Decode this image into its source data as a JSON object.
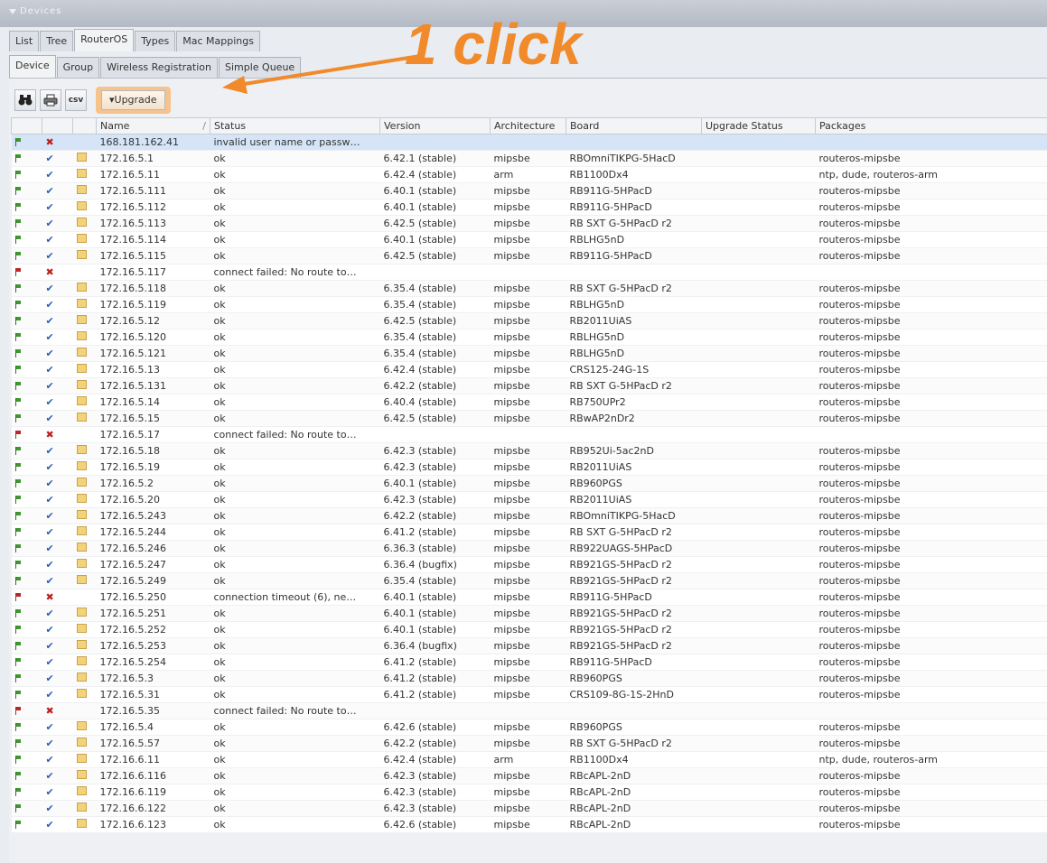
{
  "window": {
    "title": "Devices"
  },
  "top_tabs": [
    {
      "label": "List",
      "active": false
    },
    {
      "label": "Tree",
      "active": false
    },
    {
      "label": "RouterOS",
      "active": true
    },
    {
      "label": "Types",
      "active": false
    },
    {
      "label": "Mac Mappings",
      "active": false
    }
  ],
  "sub_tabs": [
    {
      "label": "Device",
      "active": true
    },
    {
      "label": "Group",
      "active": false
    },
    {
      "label": "Wireless Registration",
      "active": false
    },
    {
      "label": "Simple Queue",
      "active": false
    }
  ],
  "toolbar": {
    "find_icon": "binoculars-icon",
    "print_icon": "printer-icon",
    "csv_label": "csv",
    "upgrade_label": "▾Upgrade"
  },
  "annotation": {
    "text": "1 click",
    "color": "#f08a2a"
  },
  "columns": [
    "",
    "",
    "",
    "Name",
    "Status",
    "Version",
    "Architecture",
    "Board",
    "Upgrade Status",
    "Packages"
  ],
  "rows": [
    {
      "flag": "green",
      "ok": false,
      "lock": false,
      "name": "168.181.162.41",
      "status": "invalid user name or passw…",
      "version": "",
      "arch": "",
      "board": "",
      "upgrade": "",
      "packages": "",
      "selected": true
    },
    {
      "flag": "green",
      "ok": true,
      "lock": true,
      "name": "172.16.5.1",
      "status": "ok",
      "version": "6.42.1 (stable)",
      "arch": "mipsbe",
      "board": "RBOmniTIKPG-5HacD",
      "upgrade": "",
      "packages": "routeros-mipsbe"
    },
    {
      "flag": "green",
      "ok": true,
      "lock": true,
      "name": "172.16.5.11",
      "status": "ok",
      "version": "6.42.4 (stable)",
      "arch": "arm",
      "board": "RB1100Dx4",
      "upgrade": "",
      "packages": "ntp, dude, routeros-arm"
    },
    {
      "flag": "green",
      "ok": true,
      "lock": true,
      "name": "172.16.5.111",
      "status": "ok",
      "version": "6.40.1 (stable)",
      "arch": "mipsbe",
      "board": "RB911G-5HPacD",
      "upgrade": "",
      "packages": "routeros-mipsbe"
    },
    {
      "flag": "green",
      "ok": true,
      "lock": true,
      "name": "172.16.5.112",
      "status": "ok",
      "version": "6.40.1 (stable)",
      "arch": "mipsbe",
      "board": "RB911G-5HPacD",
      "upgrade": "",
      "packages": "routeros-mipsbe"
    },
    {
      "flag": "green",
      "ok": true,
      "lock": true,
      "name": "172.16.5.113",
      "status": "ok",
      "version": "6.42.5 (stable)",
      "arch": "mipsbe",
      "board": "RB SXT G-5HPacD r2",
      "upgrade": "",
      "packages": "routeros-mipsbe"
    },
    {
      "flag": "green",
      "ok": true,
      "lock": true,
      "name": "172.16.5.114",
      "status": "ok",
      "version": "6.40.1 (stable)",
      "arch": "mipsbe",
      "board": "RBLHG5nD",
      "upgrade": "",
      "packages": "routeros-mipsbe"
    },
    {
      "flag": "green",
      "ok": true,
      "lock": true,
      "name": "172.16.5.115",
      "status": "ok",
      "version": "6.42.5 (stable)",
      "arch": "mipsbe",
      "board": "RB911G-5HPacD",
      "upgrade": "",
      "packages": "routeros-mipsbe"
    },
    {
      "flag": "red",
      "ok": false,
      "lock": false,
      "name": "172.16.5.117",
      "status": "connect failed: No route to…",
      "version": "",
      "arch": "",
      "board": "",
      "upgrade": "",
      "packages": ""
    },
    {
      "flag": "green",
      "ok": true,
      "lock": true,
      "name": "172.16.5.118",
      "status": "ok",
      "version": "6.35.4 (stable)",
      "arch": "mipsbe",
      "board": "RB SXT G-5HPacD r2",
      "upgrade": "",
      "packages": "routeros-mipsbe"
    },
    {
      "flag": "green",
      "ok": true,
      "lock": true,
      "name": "172.16.5.119",
      "status": "ok",
      "version": "6.35.4 (stable)",
      "arch": "mipsbe",
      "board": "RBLHG5nD",
      "upgrade": "",
      "packages": "routeros-mipsbe"
    },
    {
      "flag": "green",
      "ok": true,
      "lock": true,
      "name": "172.16.5.12",
      "status": "ok",
      "version": "6.42.5 (stable)",
      "arch": "mipsbe",
      "board": "RB2011UiAS",
      "upgrade": "",
      "packages": "routeros-mipsbe"
    },
    {
      "flag": "green",
      "ok": true,
      "lock": true,
      "name": "172.16.5.120",
      "status": "ok",
      "version": "6.35.4 (stable)",
      "arch": "mipsbe",
      "board": "RBLHG5nD",
      "upgrade": "",
      "packages": "routeros-mipsbe"
    },
    {
      "flag": "green",
      "ok": true,
      "lock": true,
      "name": "172.16.5.121",
      "status": "ok",
      "version": "6.35.4 (stable)",
      "arch": "mipsbe",
      "board": "RBLHG5nD",
      "upgrade": "",
      "packages": "routeros-mipsbe"
    },
    {
      "flag": "green",
      "ok": true,
      "lock": true,
      "name": "172.16.5.13",
      "status": "ok",
      "version": "6.42.4 (stable)",
      "arch": "mipsbe",
      "board": "CRS125-24G-1S",
      "upgrade": "",
      "packages": "routeros-mipsbe"
    },
    {
      "flag": "green",
      "ok": true,
      "lock": true,
      "name": "172.16.5.131",
      "status": "ok",
      "version": "6.42.2 (stable)",
      "arch": "mipsbe",
      "board": "RB SXT G-5HPacD r2",
      "upgrade": "",
      "packages": "routeros-mipsbe"
    },
    {
      "flag": "green",
      "ok": true,
      "lock": true,
      "name": "172.16.5.14",
      "status": "ok",
      "version": "6.40.4 (stable)",
      "arch": "mipsbe",
      "board": "RB750UPr2",
      "upgrade": "",
      "packages": "routeros-mipsbe"
    },
    {
      "flag": "green",
      "ok": true,
      "lock": true,
      "name": "172.16.5.15",
      "status": "ok",
      "version": "6.42.5 (stable)",
      "arch": "mipsbe",
      "board": "RBwAP2nDr2",
      "upgrade": "",
      "packages": "routeros-mipsbe"
    },
    {
      "flag": "red",
      "ok": false,
      "lock": false,
      "name": "172.16.5.17",
      "status": "connect failed: No route to…",
      "version": "",
      "arch": "",
      "board": "",
      "upgrade": "",
      "packages": ""
    },
    {
      "flag": "green",
      "ok": true,
      "lock": true,
      "name": "172.16.5.18",
      "status": "ok",
      "version": "6.42.3 (stable)",
      "arch": "mipsbe",
      "board": "RB952Ui-5ac2nD",
      "upgrade": "",
      "packages": "routeros-mipsbe"
    },
    {
      "flag": "green",
      "ok": true,
      "lock": true,
      "name": "172.16.5.19",
      "status": "ok",
      "version": "6.42.3 (stable)",
      "arch": "mipsbe",
      "board": "RB2011UiAS",
      "upgrade": "",
      "packages": "routeros-mipsbe"
    },
    {
      "flag": "green",
      "ok": true,
      "lock": true,
      "name": "172.16.5.2",
      "status": "ok",
      "version": "6.40.1 (stable)",
      "arch": "mipsbe",
      "board": "RB960PGS",
      "upgrade": "",
      "packages": "routeros-mipsbe"
    },
    {
      "flag": "green",
      "ok": true,
      "lock": true,
      "name": "172.16.5.20",
      "status": "ok",
      "version": "6.42.3 (stable)",
      "arch": "mipsbe",
      "board": "RB2011UiAS",
      "upgrade": "",
      "packages": "routeros-mipsbe"
    },
    {
      "flag": "green",
      "ok": true,
      "lock": true,
      "name": "172.16.5.243",
      "status": "ok",
      "version": "6.42.2 (stable)",
      "arch": "mipsbe",
      "board": "RBOmniTIKPG-5HacD",
      "upgrade": "",
      "packages": "routeros-mipsbe"
    },
    {
      "flag": "green",
      "ok": true,
      "lock": true,
      "name": "172.16.5.244",
      "status": "ok",
      "version": "6.41.2 (stable)",
      "arch": "mipsbe",
      "board": "RB SXT G-5HPacD r2",
      "upgrade": "",
      "packages": "routeros-mipsbe"
    },
    {
      "flag": "green",
      "ok": true,
      "lock": true,
      "name": "172.16.5.246",
      "status": "ok",
      "version": "6.36.3 (stable)",
      "arch": "mipsbe",
      "board": "RB922UAGS-5HPacD",
      "upgrade": "",
      "packages": "routeros-mipsbe"
    },
    {
      "flag": "green",
      "ok": true,
      "lock": true,
      "name": "172.16.5.247",
      "status": "ok",
      "version": "6.36.4 (bugfix)",
      "arch": "mipsbe",
      "board": "RB921GS-5HPacD r2",
      "upgrade": "",
      "packages": "routeros-mipsbe"
    },
    {
      "flag": "green",
      "ok": true,
      "lock": true,
      "name": "172.16.5.249",
      "status": "ok",
      "version": "6.35.4 (stable)",
      "arch": "mipsbe",
      "board": "RB921GS-5HPacD r2",
      "upgrade": "",
      "packages": "routeros-mipsbe"
    },
    {
      "flag": "red",
      "ok": false,
      "lock": false,
      "name": "172.16.5.250",
      "status": "connection timeout (6), ne…",
      "version": "6.40.1 (stable)",
      "arch": "mipsbe",
      "board": "RB911G-5HPacD",
      "upgrade": "",
      "packages": "routeros-mipsbe"
    },
    {
      "flag": "green",
      "ok": true,
      "lock": true,
      "name": "172.16.5.251",
      "status": "ok",
      "version": "6.40.1 (stable)",
      "arch": "mipsbe",
      "board": "RB921GS-5HPacD r2",
      "upgrade": "",
      "packages": "routeros-mipsbe"
    },
    {
      "flag": "green",
      "ok": true,
      "lock": true,
      "name": "172.16.5.252",
      "status": "ok",
      "version": "6.40.1 (stable)",
      "arch": "mipsbe",
      "board": "RB921GS-5HPacD r2",
      "upgrade": "",
      "packages": "routeros-mipsbe"
    },
    {
      "flag": "green",
      "ok": true,
      "lock": true,
      "name": "172.16.5.253",
      "status": "ok",
      "version": "6.36.4 (bugfix)",
      "arch": "mipsbe",
      "board": "RB921GS-5HPacD r2",
      "upgrade": "",
      "packages": "routeros-mipsbe"
    },
    {
      "flag": "green",
      "ok": true,
      "lock": true,
      "name": "172.16.5.254",
      "status": "ok",
      "version": "6.41.2 (stable)",
      "arch": "mipsbe",
      "board": "RB911G-5HPacD",
      "upgrade": "",
      "packages": "routeros-mipsbe"
    },
    {
      "flag": "green",
      "ok": true,
      "lock": true,
      "name": "172.16.5.3",
      "status": "ok",
      "version": "6.41.2 (stable)",
      "arch": "mipsbe",
      "board": "RB960PGS",
      "upgrade": "",
      "packages": "routeros-mipsbe"
    },
    {
      "flag": "green",
      "ok": true,
      "lock": true,
      "name": "172.16.5.31",
      "status": "ok",
      "version": "6.41.2 (stable)",
      "arch": "mipsbe",
      "board": "CRS109-8G-1S-2HnD",
      "upgrade": "",
      "packages": "routeros-mipsbe"
    },
    {
      "flag": "red",
      "ok": false,
      "lock": false,
      "name": "172.16.5.35",
      "status": "connect failed: No route to…",
      "version": "",
      "arch": "",
      "board": "",
      "upgrade": "",
      "packages": ""
    },
    {
      "flag": "green",
      "ok": true,
      "lock": true,
      "name": "172.16.5.4",
      "status": "ok",
      "version": "6.42.6 (stable)",
      "arch": "mipsbe",
      "board": "RB960PGS",
      "upgrade": "",
      "packages": "routeros-mipsbe"
    },
    {
      "flag": "green",
      "ok": true,
      "lock": true,
      "name": "172.16.5.57",
      "status": "ok",
      "version": "6.42.2 (stable)",
      "arch": "mipsbe",
      "board": "RB SXT G-5HPacD r2",
      "upgrade": "",
      "packages": "routeros-mipsbe"
    },
    {
      "flag": "green",
      "ok": true,
      "lock": true,
      "name": "172.16.6.11",
      "status": "ok",
      "version": "6.42.4 (stable)",
      "arch": "arm",
      "board": "RB1100Dx4",
      "upgrade": "",
      "packages": "ntp, dude, routeros-arm"
    },
    {
      "flag": "green",
      "ok": true,
      "lock": true,
      "name": "172.16.6.116",
      "status": "ok",
      "version": "6.42.3 (stable)",
      "arch": "mipsbe",
      "board": "RBcAPL-2nD",
      "upgrade": "",
      "packages": "routeros-mipsbe"
    },
    {
      "flag": "green",
      "ok": true,
      "lock": true,
      "name": "172.16.6.119",
      "status": "ok",
      "version": "6.42.3 (stable)",
      "arch": "mipsbe",
      "board": "RBcAPL-2nD",
      "upgrade": "",
      "packages": "routeros-mipsbe"
    },
    {
      "flag": "green",
      "ok": true,
      "lock": true,
      "name": "172.16.6.122",
      "status": "ok",
      "version": "6.42.3 (stable)",
      "arch": "mipsbe",
      "board": "RBcAPL-2nD",
      "upgrade": "",
      "packages": "routeros-mipsbe"
    },
    {
      "flag": "green",
      "ok": true,
      "lock": true,
      "name": "172.16.6.123",
      "status": "ok",
      "version": "6.42.6 (stable)",
      "arch": "mipsbe",
      "board": "RBcAPL-2nD",
      "upgrade": "",
      "packages": "routeros-mipsbe"
    }
  ]
}
